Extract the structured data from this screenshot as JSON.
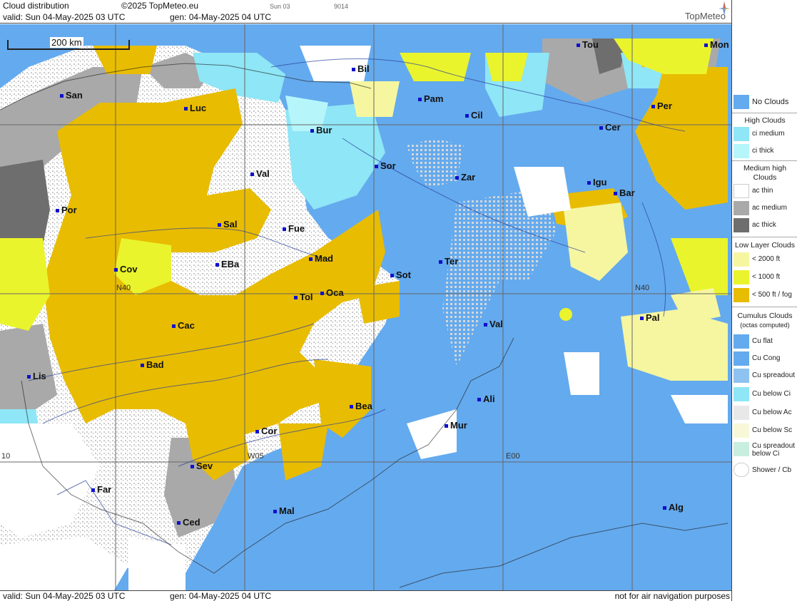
{
  "header": {
    "title": "Cloud distribution",
    "copyright": "©2025 TopMeteo.eu",
    "valid": "valid:  Sun  04-May-2025  03 UTC",
    "gen": "gen: 04-May-2025 04 UTC",
    "frame_day": "Sun 03",
    "frame_code": "9014",
    "brand": "TopMeteo"
  },
  "footer": {
    "valid": "valid:  Sun  04-May-2025  03 UTC",
    "gen": "gen: 04-May-2025 04 UTC",
    "note": "not for air navigation purposes"
  },
  "scale_label": "200 km",
  "grid_labels": {
    "n40_left": "N40",
    "n40_right": "N40",
    "w05": "W05",
    "e00": "E00",
    "w10": "10"
  },
  "cities": [
    "San",
    "Luc",
    "Bil",
    "Pam",
    "Cil",
    "Tou",
    "Mon",
    "Per",
    "Cer",
    "Bur",
    "Sor",
    "Zar",
    "Val",
    "Por",
    "Sal",
    "Fue",
    "Igu",
    "Bar",
    "Mad",
    "Cov",
    "EBa",
    "Sot",
    "Ter",
    "Tol",
    "Oca",
    "Pal",
    "Cac",
    "Val",
    "Bad",
    "Lis",
    "Ali",
    "Bea",
    "Cor",
    "Mur",
    "Sev",
    "Far",
    "Mal",
    "Alg",
    "Ced"
  ],
  "legend": {
    "no_clouds": "No Clouds",
    "high_head": "High Clouds",
    "ci_medium": "ci medium",
    "ci_thick": "ci thick",
    "medium_head": "Medium high Clouds",
    "ac_thin": "ac thin",
    "ac_medium": "ac medium",
    "ac_thick": "ac thick",
    "low_head": "Low Layer Clouds",
    "lt2000": "< 2000 ft",
    "lt1000": "< 1000 ft",
    "lt500": "< 500 ft / fog",
    "cu_head": "Cumulus Clouds",
    "cu_sub": "(octas computed)",
    "cu_flat": "Cu flat",
    "cu_cong": "Cu Cong",
    "cu_spread": "Cu spreadout",
    "cu_below_ci": "Cu below Ci",
    "cu_below_ac": "Cu below Ac",
    "cu_below_sc": "Cu below Sc",
    "cu_spread_ci": "Cu spreadout below Ci",
    "shower": "Shower / Cb"
  },
  "colors": {
    "no_clouds": "#64aaee",
    "ci_medium": "#8ee6f6",
    "ci_thick": "#b6f6fa",
    "ac_thin": "#ffffff",
    "ac_medium": "#a9a9a9",
    "ac_thick": "#6e6e6e",
    "low_2000": "#f6f6a0",
    "low_1000": "#eaf42c",
    "low_500": "#e8bc00"
  }
}
